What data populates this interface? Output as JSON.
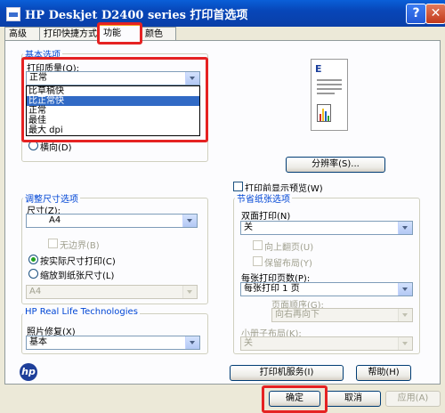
{
  "window": {
    "title": "HP Deskjet D2400 series 打印首选项",
    "help_glyph": "?",
    "close_glyph": "✕"
  },
  "tabs": [
    {
      "label": "高级"
    },
    {
      "label": "打印快捷方式"
    },
    {
      "label": "功能"
    },
    {
      "label": "颜色"
    }
  ],
  "basic_options": {
    "group_title": "基本选项",
    "quality_label": "打印质量(Q):",
    "quality_value": "正常",
    "quality_options": [
      "比草稿快",
      "比正常快",
      "正常",
      "最佳",
      "最大 dpi"
    ],
    "landscape_label": "横向(D)",
    "resolution_button": "分辨率(S)..."
  },
  "resize": {
    "group_title": "调整尺寸选项",
    "size_label": "尺寸(Z):",
    "size_value": "A4",
    "borderless_label": "无边界(B)",
    "actual_size_label": "按实际尺寸打印(C)",
    "fit_to_paper_label": "缩放到纸张尺寸(L)",
    "fit_value": "A4"
  },
  "real_life": {
    "group_title": "HP Real Life Technologies",
    "photo_fix_label": "照片修复(X)",
    "photo_fix_value": "基本"
  },
  "preview_checkbox_label": "打印前显示预览(W)",
  "paper_saving": {
    "group_title": "节省纸张选项",
    "duplex_label": "双面打印(N)",
    "duplex_value": "关",
    "flip_up_label": "向上翻页(U)",
    "keep_layout_label": "保留布局(Y)",
    "pages_per_sheet_label": "每张打印页数(P):",
    "pages_per_sheet_value": "每张打印 1 页",
    "page_order_label": "页面顺序(G):",
    "page_order_value": "向右再向下",
    "booklet_label": "小册子布局(K):",
    "booklet_value": "关"
  },
  "footer": {
    "logo_text": "hp",
    "printer_services": "打印机服务(I)",
    "help": "帮助(H)",
    "ok": "确定",
    "cancel": "取消",
    "apply": "应用(A)"
  },
  "colors": {
    "highlight": "#e52222",
    "accent_tab": "#f5a020",
    "selection": "#316ac5",
    "group_title": "#0046d5"
  }
}
